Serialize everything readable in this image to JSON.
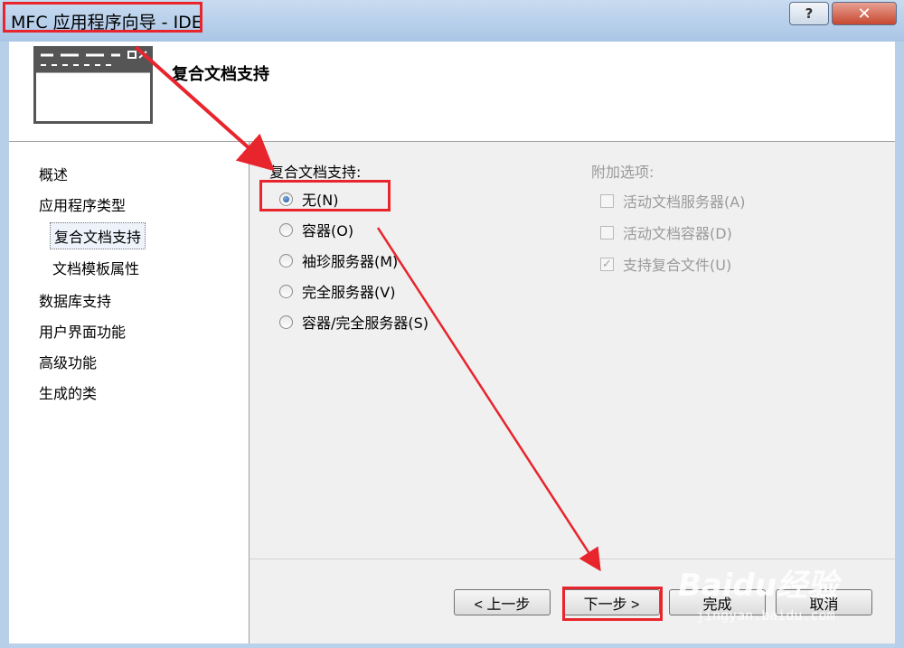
{
  "window": {
    "title": "MFC 应用程序向导 - IDE",
    "help_glyph": "?",
    "close_glyph": "✕"
  },
  "header": {
    "title": "复合文档支持"
  },
  "nav": {
    "items": [
      {
        "label": "概述"
      },
      {
        "label": "应用程序类型"
      },
      {
        "label": "复合文档支持"
      },
      {
        "label": "文档模板属性"
      },
      {
        "label": "数据库支持"
      },
      {
        "label": "用户界面功能"
      },
      {
        "label": "高级功能"
      },
      {
        "label": "生成的类"
      }
    ],
    "active_index": 2
  },
  "compound": {
    "group_label": "复合文档支持:",
    "options": [
      {
        "label": "无(N)",
        "checked": true
      },
      {
        "label": "容器(O)",
        "checked": false
      },
      {
        "label": "袖珍服务器(M)",
        "checked": false
      },
      {
        "label": "完全服务器(V)",
        "checked": false
      },
      {
        "label": "容器/完全服务器(S)",
        "checked": false
      }
    ]
  },
  "additional": {
    "group_label": "附加选项:",
    "options": [
      {
        "label": "活动文档服务器(A)",
        "checked": false
      },
      {
        "label": "活动文档容器(D)",
        "checked": false
      },
      {
        "label": "支持复合文件(U)",
        "checked": true
      }
    ],
    "check_glyph": "✓"
  },
  "buttons": {
    "back": "< 上一步",
    "next": "下一步 >",
    "finish": "完成",
    "cancel": "取消"
  },
  "watermark": {
    "brand": "Baidu经验",
    "url": "jingyan.baidu.com"
  },
  "colors": {
    "annotation_red": "#e8242c",
    "radio_accent": "#1c4c8a"
  }
}
